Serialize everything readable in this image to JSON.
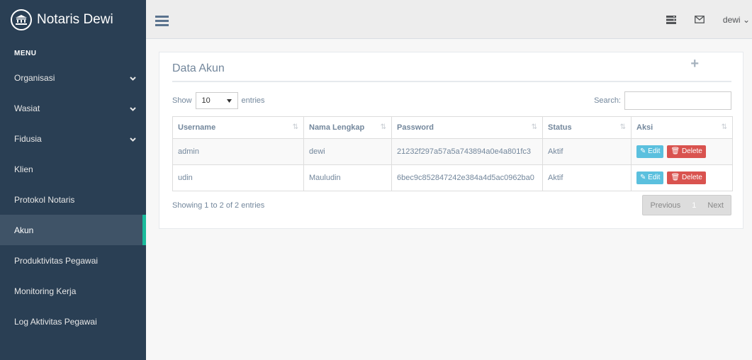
{
  "brand": {
    "title": "Notaris Dewi"
  },
  "sidebar": {
    "heading": "MENU",
    "items": [
      {
        "label": "Organisasi",
        "has_chevron": true
      },
      {
        "label": "Wasiat",
        "has_chevron": true
      },
      {
        "label": "Fidusia",
        "has_chevron": true
      },
      {
        "label": "Klien"
      },
      {
        "label": "Protokol Notaris"
      },
      {
        "label": "Akun",
        "active": true
      },
      {
        "label": "Produktivitas Pegawai"
      },
      {
        "label": "Monitoring Kerja"
      },
      {
        "label": "Log Aktivitas Pegawai"
      }
    ]
  },
  "topnav": {
    "user": "dewi",
    "user_caret": "⌄"
  },
  "panel": {
    "title": "Data Akun",
    "add_icon": "+",
    "length_label_pre": "Show",
    "length_value": "10",
    "length_label_post": "entries",
    "search_label": "Search:",
    "columns": [
      "Username",
      "Nama Lengkap",
      "Password",
      "Status",
      "Aksi"
    ],
    "rows": [
      {
        "username": "admin",
        "nama": "dewi",
        "password": "21232f297a57a5a743894a0e4a801fc3",
        "status": "Aktif"
      },
      {
        "username": "udin",
        "nama": "Mauludin",
        "password": "6bec9c852847242e384a4d5ac0962ba0",
        "status": "Aktif"
      }
    ],
    "edit_label": "Edit",
    "delete_label": "Delete",
    "info": "Showing 1 to 2 of 2 entries",
    "pagination": {
      "previous": "Previous",
      "current": "1",
      "next": "Next"
    }
  },
  "colors": {
    "sidebar": "#2A3F54",
    "accent": "#1ABB9C",
    "info": "#5BC0DE",
    "danger": "#D9534F"
  }
}
